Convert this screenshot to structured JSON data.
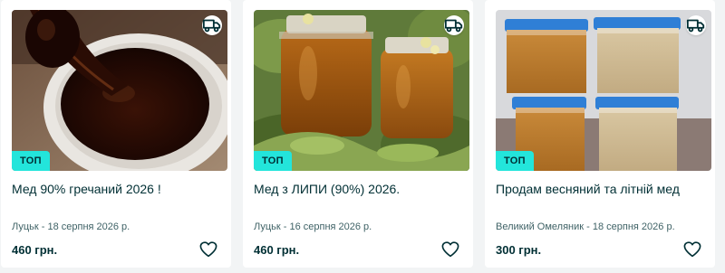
{
  "listings": [
    {
      "title": "Мед 90% гречаний 2026 !",
      "badge": "ТОП",
      "location_date": "Луцьк - 18 серпня 2026 р.",
      "price": "460 грн.",
      "delivery_icon": "truck-icon",
      "favorite_icon": "heart-icon"
    },
    {
      "title": "Мед з ЛИПИ (90%) 2026.",
      "badge": "ТОП",
      "location_date": "Луцьк - 16 серпня 2026 р.",
      "price": "460 грн.",
      "delivery_icon": "truck-icon",
      "favorite_icon": "heart-icon"
    },
    {
      "title": "Продам весняний та літній мед",
      "badge": "ТОП",
      "location_date": "Великий Омеляник - 18 серпня 2026 р.",
      "price": "300 грн.",
      "delivery_icon": "truck-icon",
      "favorite_icon": "heart-icon"
    }
  ],
  "colors": {
    "badge_bg": "#23e5db",
    "text_primary": "#002f34",
    "text_secondary": "#406367",
    "page_bg": "#f2f4f5"
  }
}
